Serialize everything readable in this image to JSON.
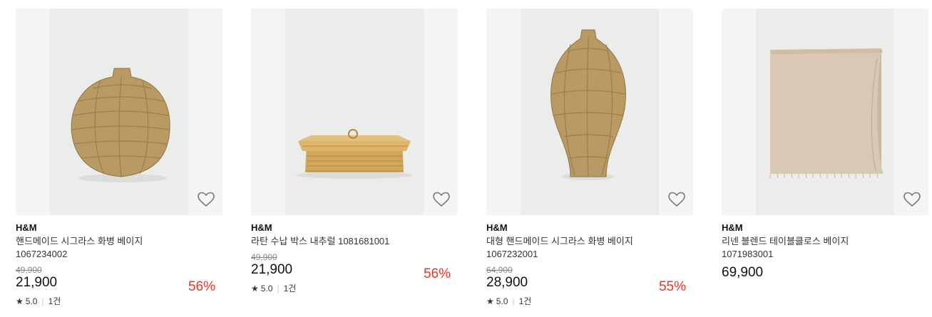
{
  "products": [
    {
      "brand": "H&M",
      "name": "핸드메이드 시그라스 화병 베이지",
      "code": "1067234002",
      "original_price": "49,900",
      "price": "21,900",
      "discount": "56%",
      "rating": "5.0",
      "reviews": "1건",
      "image": "seagrass-round-vase"
    },
    {
      "brand": "H&M",
      "name": "라탄 수납 박스 내추럴 1081681001",
      "original_price": "49,900",
      "price": "21,900",
      "discount": "56%",
      "rating": "5.0",
      "reviews": "1건",
      "image": "rattan-storage-box"
    },
    {
      "brand": "H&M",
      "name": "대형 핸드메이드 시그라스 화병 베이지",
      "code": "1067232001",
      "original_price": "64,900",
      "price": "28,900",
      "discount": "55%",
      "rating": "5.0",
      "reviews": "1건",
      "image": "seagrass-tall-vase"
    },
    {
      "brand": "H&M",
      "name": "리넨 블렌드 테이블클로스 베이지",
      "code": "1071983001",
      "price": "69,900",
      "image": "linen-tablecloth"
    }
  ],
  "icons": {
    "wishlist": "heart-outline-icon",
    "rating": "star-icon"
  },
  "colors": {
    "discount": "#e23a2c",
    "image_bg": "#f5f5f5"
  }
}
